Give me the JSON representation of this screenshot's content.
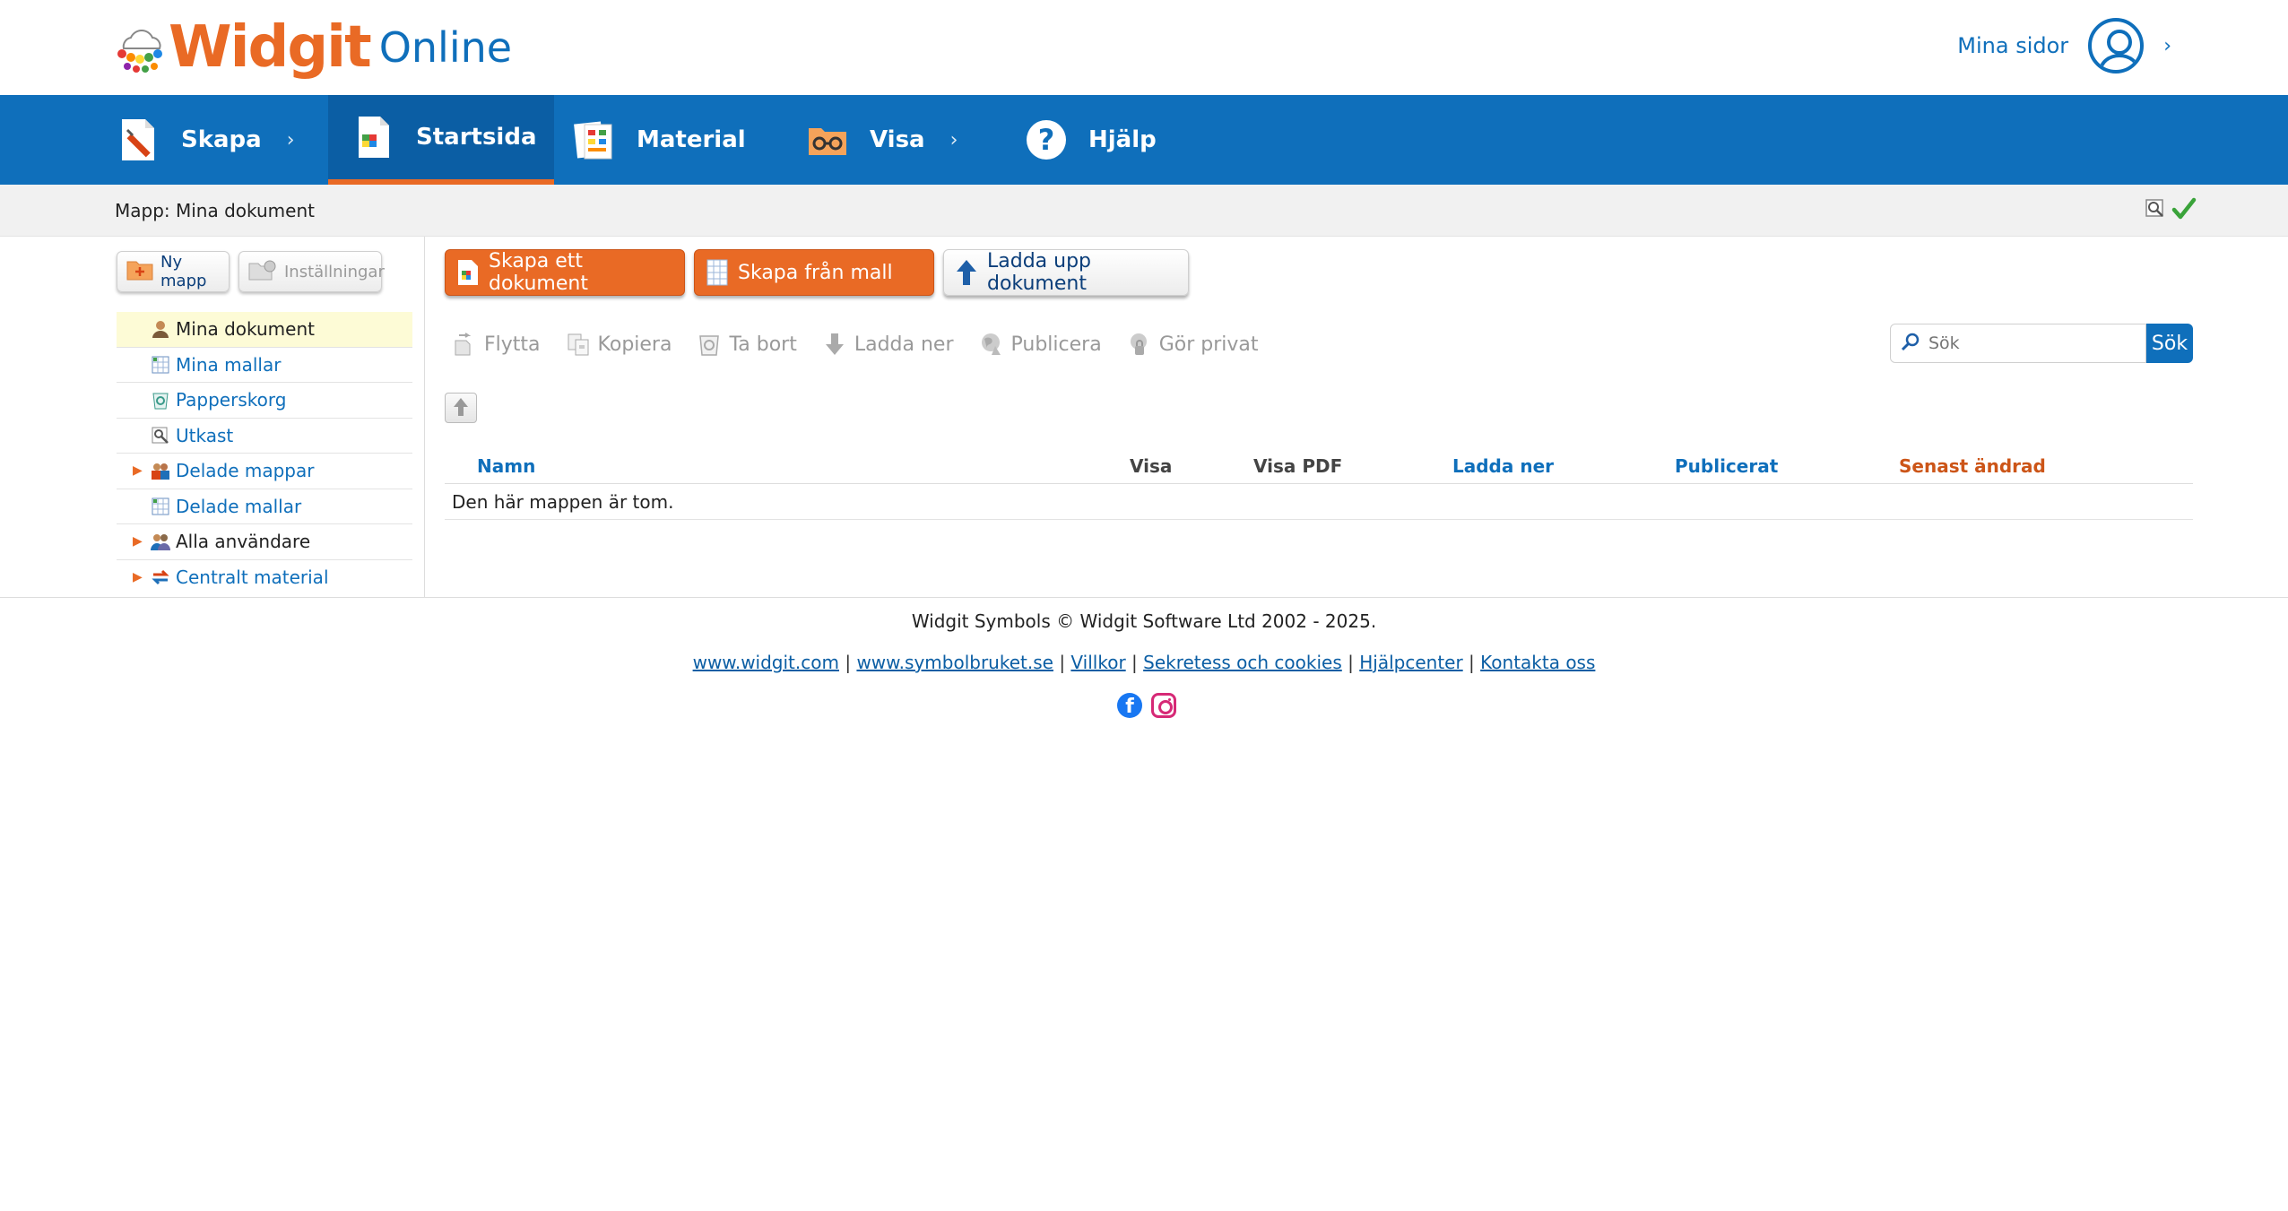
{
  "logo": {
    "word": "Widgit",
    "suffix": "Online"
  },
  "account": {
    "label": "Mina sidor",
    "chevron": "›"
  },
  "nav": {
    "items": [
      {
        "label": "Skapa",
        "icon": "pencil-document-icon",
        "has_chevron": true
      },
      {
        "label": "Startsida",
        "icon": "home-document-icon",
        "active": true
      },
      {
        "label": "Material",
        "icon": "material-icon"
      },
      {
        "label": "Visa",
        "icon": "glasses-folder-icon",
        "has_chevron": true
      },
      {
        "label": "Hjälp",
        "icon": "help-icon"
      }
    ],
    "chevron": "›"
  },
  "breadcrumb": {
    "text": "Mapp: Mina dokument"
  },
  "sidebar": {
    "new_folder_label": "Ny mapp",
    "settings_label": "Inställningar",
    "tree": [
      {
        "label": "Mina dokument",
        "selected": true,
        "expandable": false
      },
      {
        "label": "Mina mallar",
        "expandable": false
      },
      {
        "label": "Papperskorg",
        "expandable": false
      },
      {
        "label": "Utkast",
        "expandable": false
      },
      {
        "label": "Delade mappar",
        "expandable": true
      },
      {
        "label": "Delade mallar",
        "expandable": false
      },
      {
        "label": "Alla användare",
        "expandable": true
      },
      {
        "label": "Centralt material",
        "expandable": true
      }
    ]
  },
  "actions": {
    "create_document": "Skapa ett dokument",
    "create_from_template": "Skapa från mall",
    "upload_document": "Ladda upp dokument"
  },
  "toolbar": {
    "move": "Flytta",
    "copy": "Kopiera",
    "delete": "Ta bort",
    "download": "Ladda ner",
    "publish": "Publicera",
    "make_private": "Gör privat"
  },
  "search": {
    "placeholder": "Sök",
    "button_label": "Sök"
  },
  "table": {
    "columns": [
      "Namn",
      "Visa",
      "Visa PDF",
      "Ladda ner",
      "Publicerat",
      "Senast ändrad"
    ],
    "empty_message": "Den här mappen är tom."
  },
  "footer": {
    "copyright": "Widgit Symbols © Widgit Software Ltd 2002 - 2025.",
    "links": [
      "www.widgit.com",
      "www.symbolbruket.se",
      "Villkor",
      "Sekretess och cookies",
      "Hjälpcenter",
      "Kontakta oss"
    ],
    "separator": "|"
  },
  "colors": {
    "brand_blue": "#0f6fbb",
    "brand_orange": "#e96a25",
    "selected_row": "#fdfbd6",
    "sorted_column": "#cc5518"
  }
}
